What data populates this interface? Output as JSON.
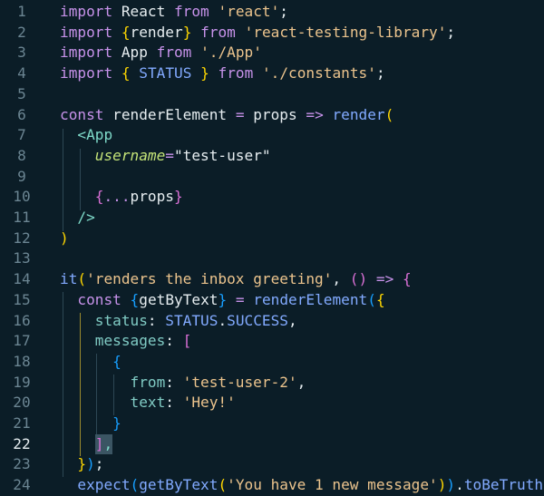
{
  "editor": {
    "language": "javascript-jsx",
    "current_line": 22,
    "colors": {
      "background": "#0b1d27",
      "line_number": "#6b8592",
      "line_number_current": "#e6edf0",
      "keyword": "#c792ea",
      "string": "#ecc48d",
      "function": "#82aaff",
      "jsx_tag": "#7fdbca",
      "jsx_attribute": "#c5e478",
      "property": "#80cbc4",
      "bracket_gold": "#ffd700",
      "bracket_orchid": "#da70d6",
      "bracket_blue": "#179fff"
    },
    "lines": [
      {
        "num": "1",
        "tokens": [
          [
            "kw",
            "import"
          ],
          [
            "id",
            " React "
          ],
          [
            "kw",
            "from"
          ],
          [
            "plain",
            " "
          ],
          [
            "str",
            "'react'"
          ],
          [
            "plain",
            ";"
          ]
        ]
      },
      {
        "num": "2",
        "tokens": [
          [
            "kw",
            "import"
          ],
          [
            "plain",
            " "
          ],
          [
            "br1",
            "{"
          ],
          [
            "id",
            "render"
          ],
          [
            "br1",
            "}"
          ],
          [
            "plain",
            " "
          ],
          [
            "kw",
            "from"
          ],
          [
            "plain",
            " "
          ],
          [
            "str",
            "'react-testing-library'"
          ],
          [
            "plain",
            ";"
          ]
        ]
      },
      {
        "num": "3",
        "tokens": [
          [
            "kw",
            "import"
          ],
          [
            "id",
            " App "
          ],
          [
            "kw",
            "from"
          ],
          [
            "plain",
            " "
          ],
          [
            "str",
            "'./App'"
          ]
        ]
      },
      {
        "num": "4",
        "tokens": [
          [
            "kw",
            "import"
          ],
          [
            "plain",
            " "
          ],
          [
            "br1",
            "{"
          ],
          [
            "plain",
            " "
          ],
          [
            "cst",
            "STATUS"
          ],
          [
            "plain",
            " "
          ],
          [
            "br1",
            "}"
          ],
          [
            "plain",
            " "
          ],
          [
            "kw",
            "from"
          ],
          [
            "plain",
            " "
          ],
          [
            "str",
            "'./constants'"
          ],
          [
            "plain",
            ";"
          ]
        ]
      },
      {
        "num": "5",
        "tokens": []
      },
      {
        "num": "6",
        "tokens": [
          [
            "kw",
            "const"
          ],
          [
            "plain",
            " "
          ],
          [
            "id",
            "renderElement"
          ],
          [
            "plain",
            " "
          ],
          [
            "op",
            "="
          ],
          [
            "plain",
            " "
          ],
          [
            "id",
            "props"
          ],
          [
            "plain",
            " "
          ],
          [
            "arr",
            "=>"
          ],
          [
            "plain",
            " "
          ],
          [
            "fn",
            "render"
          ],
          [
            "br1",
            "("
          ]
        ]
      },
      {
        "num": "7",
        "tokens": [
          [
            "plain",
            "  "
          ],
          [
            "tag",
            "<App"
          ]
        ]
      },
      {
        "num": "8",
        "tokens": [
          [
            "plain",
            "    "
          ],
          [
            "attr",
            "username"
          ],
          [
            "op",
            "="
          ],
          [
            "plain",
            "\"test-user\""
          ]
        ]
      },
      {
        "num": "9",
        "tokens": []
      },
      {
        "num": "10",
        "tokens": [
          [
            "plain",
            "    "
          ],
          [
            "br2",
            "{"
          ],
          [
            "op",
            "..."
          ],
          [
            "id",
            "props"
          ],
          [
            "br2",
            "}"
          ]
        ]
      },
      {
        "num": "11",
        "tokens": [
          [
            "plain",
            "  "
          ],
          [
            "tag",
            "/>"
          ]
        ]
      },
      {
        "num": "12",
        "tokens": [
          [
            "br1",
            ")"
          ]
        ]
      },
      {
        "num": "13",
        "tokens": []
      },
      {
        "num": "14",
        "tokens": [
          [
            "fn",
            "it"
          ],
          [
            "br1",
            "("
          ],
          [
            "str",
            "'renders the inbox greeting'"
          ],
          [
            "plain",
            ", "
          ],
          [
            "br2",
            "()"
          ],
          [
            "plain",
            " "
          ],
          [
            "arr",
            "=>"
          ],
          [
            "plain",
            " "
          ],
          [
            "br2",
            "{"
          ]
        ]
      },
      {
        "num": "15",
        "tokens": [
          [
            "plain",
            "  "
          ],
          [
            "kw",
            "const"
          ],
          [
            "plain",
            " "
          ],
          [
            "br3",
            "{"
          ],
          [
            "id",
            "getByText"
          ],
          [
            "br3",
            "}"
          ],
          [
            "plain",
            " "
          ],
          [
            "op",
            "="
          ],
          [
            "plain",
            " "
          ],
          [
            "fn",
            "renderElement"
          ],
          [
            "br3",
            "("
          ],
          [
            "br1",
            "{"
          ]
        ]
      },
      {
        "num": "16",
        "tokens": [
          [
            "plain",
            "    "
          ],
          [
            "prop",
            "status"
          ],
          [
            "plain",
            ": "
          ],
          [
            "cst",
            "STATUS"
          ],
          [
            "plain",
            "."
          ],
          [
            "cst",
            "SUCCESS"
          ],
          [
            "plain",
            ","
          ]
        ]
      },
      {
        "num": "17",
        "tokens": [
          [
            "plain",
            "    "
          ],
          [
            "prop",
            "messages"
          ],
          [
            "plain",
            ": "
          ],
          [
            "br2",
            "["
          ]
        ]
      },
      {
        "num": "18",
        "tokens": [
          [
            "plain",
            "      "
          ],
          [
            "br3",
            "{"
          ]
        ]
      },
      {
        "num": "19",
        "tokens": [
          [
            "plain",
            "        "
          ],
          [
            "prop",
            "from"
          ],
          [
            "plain",
            ": "
          ],
          [
            "str",
            "'test-user-2'"
          ],
          [
            "plain",
            ","
          ]
        ]
      },
      {
        "num": "20",
        "tokens": [
          [
            "plain",
            "        "
          ],
          [
            "prop",
            "text"
          ],
          [
            "plain",
            ": "
          ],
          [
            "str",
            "'Hey!'"
          ]
        ]
      },
      {
        "num": "21",
        "tokens": [
          [
            "plain",
            "      "
          ],
          [
            "br3",
            "}"
          ]
        ]
      },
      {
        "num": "22",
        "tokens": [
          [
            "plain",
            "    "
          ],
          [
            "br2",
            "]"
          ],
          [
            "punc",
            ","
          ]
        ]
      },
      {
        "num": "23",
        "tokens": [
          [
            "plain",
            "  "
          ],
          [
            "br1",
            "}"
          ],
          [
            "br3",
            ")"
          ],
          [
            "plain",
            ";"
          ]
        ]
      },
      {
        "num": "24",
        "tokens": [
          [
            "plain",
            "  "
          ],
          [
            "fn",
            "expect"
          ],
          [
            "br3",
            "("
          ],
          [
            "fn",
            "getByText"
          ],
          [
            "br1",
            "("
          ],
          [
            "str",
            "'You have 1 new message'"
          ],
          [
            "br1",
            ")"
          ],
          [
            "br3",
            ")"
          ],
          [
            "plain",
            "."
          ],
          [
            "fn",
            "toBeTruthy"
          ],
          [
            "br3",
            "()"
          ]
        ]
      }
    ]
  }
}
